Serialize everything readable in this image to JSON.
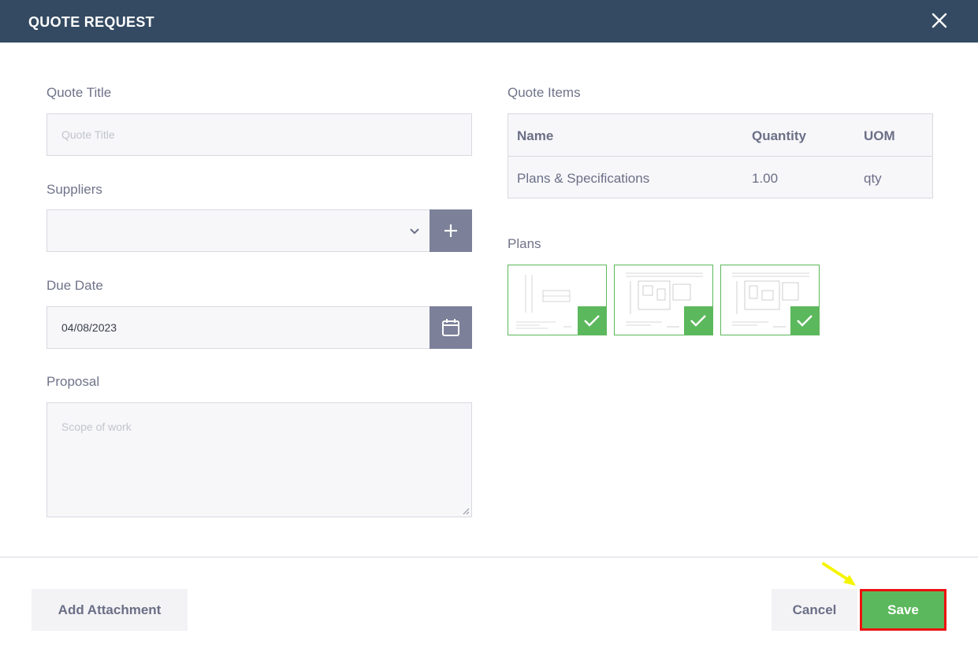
{
  "header": {
    "title": "QUOTE REQUEST"
  },
  "form": {
    "quote_title_label": "Quote Title",
    "quote_title_placeholder": "Quote Title",
    "quote_title_value": "",
    "suppliers_label": "Suppliers",
    "suppliers_value": "",
    "due_date_label": "Due Date",
    "due_date_value": "04/08/2023",
    "proposal_label": "Proposal",
    "proposal_placeholder": "Scope of work"
  },
  "quote_items": {
    "label": "Quote Items",
    "columns": [
      "Name",
      "Quantity",
      "UOM"
    ],
    "rows": [
      {
        "name": "Plans & Specifications",
        "quantity": "1.00",
        "uom": "qty"
      }
    ]
  },
  "plans": {
    "label": "Plans",
    "items": [
      {
        "selected": true
      },
      {
        "selected": true
      },
      {
        "selected": true
      }
    ]
  },
  "footer": {
    "add_attachment": "Add Attachment",
    "cancel": "Cancel",
    "save": "Save"
  },
  "colors": {
    "header_bg": "#344a62",
    "accent_green": "#5cb85c",
    "icon_button_bg": "#7c8099",
    "highlight_red": "#ee1111",
    "annotation_arrow": "#f5f500"
  },
  "icons": {
    "close": "close-icon",
    "dropdown": "chevron-down-icon",
    "add": "plus-icon",
    "calendar": "calendar-icon",
    "check": "check-icon"
  }
}
